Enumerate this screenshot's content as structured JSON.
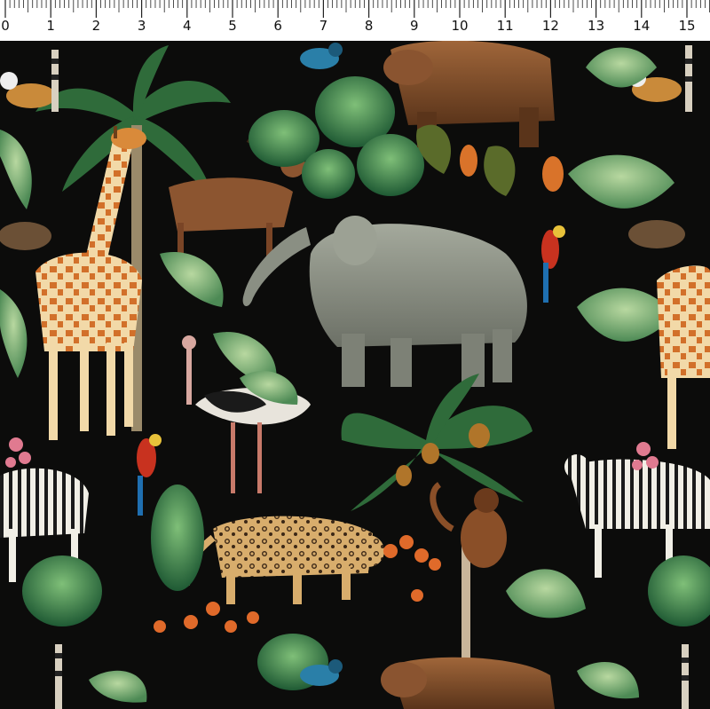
{
  "ruler": {
    "labels": [
      "0",
      "1",
      "2",
      "3",
      "4",
      "5",
      "6",
      "7",
      "8",
      "9",
      "10",
      "11",
      "12",
      "13",
      "14",
      "15"
    ],
    "unit_spacing_note": ""
  },
  "pattern": {
    "subject": "jungle animals fabric print",
    "background_color": "#0c0c0b",
    "animals": [
      "giraffe",
      "elephant",
      "antelope",
      "bear",
      "lemur",
      "ostrich",
      "parrot",
      "leopard",
      "zebra",
      "monkey",
      "hedgehog",
      "bird"
    ],
    "colors": {
      "foliage_dark": "#1f5a34",
      "foliage_light": "#6fa86a",
      "giraffe": "#d98a3a",
      "elephant": "#8a8f83",
      "bear": "#7b4a26",
      "leopard": "#c99a5c",
      "parrot_red": "#c8321f",
      "bird_blue": "#2a7fa8",
      "flower_orange": "#e06a2a"
    }
  }
}
